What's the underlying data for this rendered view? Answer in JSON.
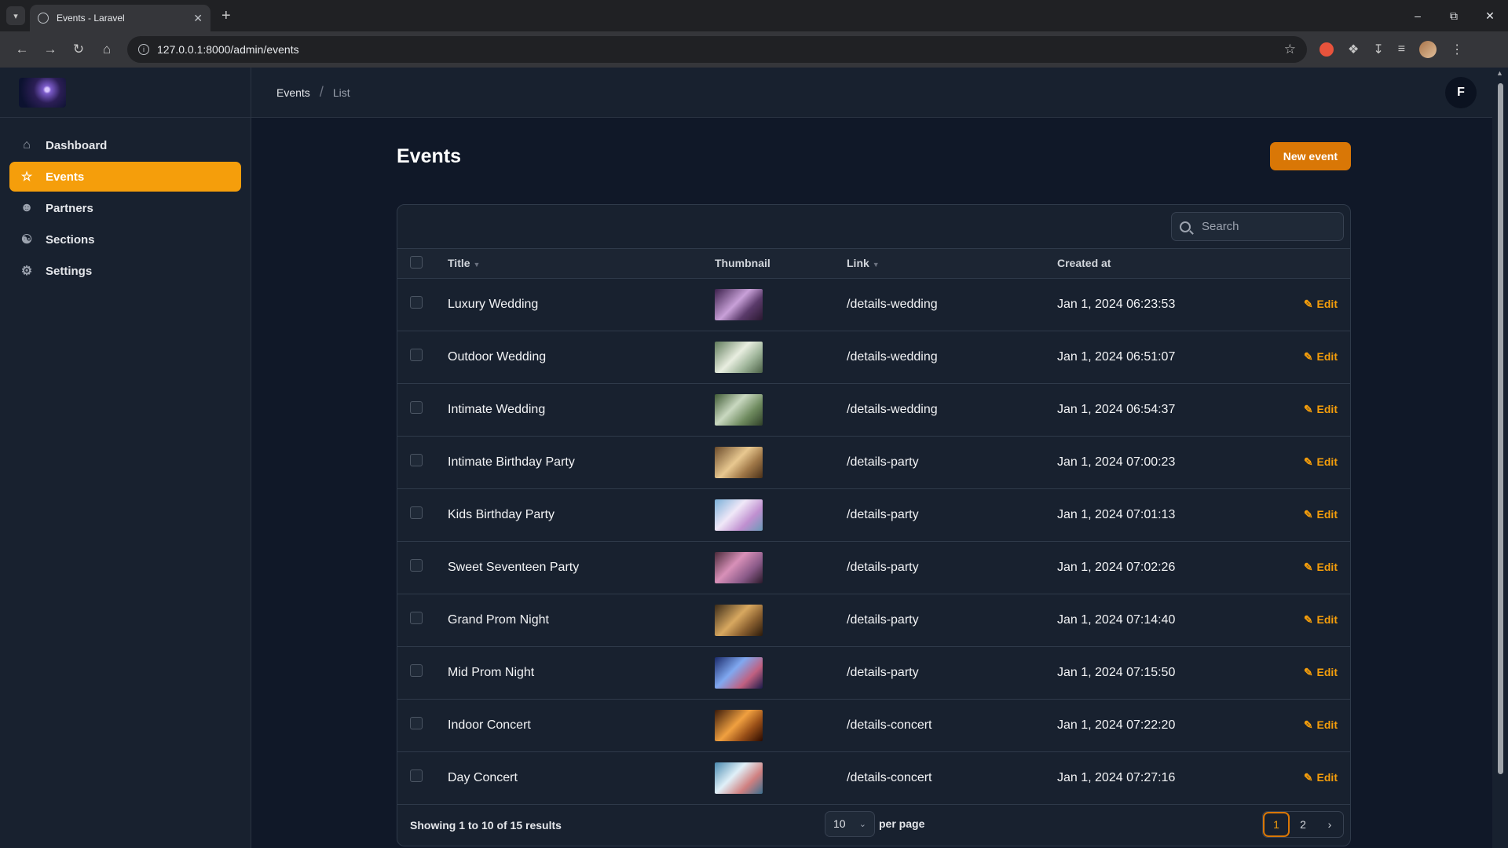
{
  "browser": {
    "tab_title": "Events - Laravel",
    "url": "127.0.0.1:8000/admin/events"
  },
  "sidebar": {
    "items": [
      {
        "label": "Dashboard",
        "icon": "home-icon",
        "active": false
      },
      {
        "label": "Events",
        "icon": "star-icon",
        "active": true
      },
      {
        "label": "Partners",
        "icon": "users-icon",
        "active": false
      },
      {
        "label": "Sections",
        "icon": "user-group-icon",
        "active": false
      },
      {
        "label": "Settings",
        "icon": "gear-icon",
        "active": false
      }
    ]
  },
  "topbar": {
    "breadcrumb": [
      "Events",
      "List"
    ],
    "user_initial": "F"
  },
  "page": {
    "title": "Events",
    "new_button": "New event"
  },
  "table": {
    "search_placeholder": "Search",
    "columns": [
      "Title",
      "Thumbnail",
      "Link",
      "Created at"
    ],
    "rows": [
      {
        "title": "Luxury Wedding",
        "link": "/details-wedding",
        "created": "Jan 1, 2024 06:23:53",
        "action": "Edit"
      },
      {
        "title": "Outdoor Wedding",
        "link": "/details-wedding",
        "created": "Jan 1, 2024 06:51:07",
        "action": "Edit"
      },
      {
        "title": "Intimate Wedding",
        "link": "/details-wedding",
        "created": "Jan 1, 2024 06:54:37",
        "action": "Edit"
      },
      {
        "title": "Intimate Birthday Party",
        "link": "/details-party",
        "created": "Jan 1, 2024 07:00:23",
        "action": "Edit"
      },
      {
        "title": "Kids Birthday Party",
        "link": "/details-party",
        "created": "Jan 1, 2024 07:01:13",
        "action": "Edit"
      },
      {
        "title": "Sweet Seventeen Party",
        "link": "/details-party",
        "created": "Jan 1, 2024 07:02:26",
        "action": "Edit"
      },
      {
        "title": "Grand Prom Night",
        "link": "/details-party",
        "created": "Jan 1, 2024 07:14:40",
        "action": "Edit"
      },
      {
        "title": "Mid Prom Night",
        "link": "/details-party",
        "created": "Jan 1, 2024 07:15:50",
        "action": "Edit"
      },
      {
        "title": "Indoor Concert",
        "link": "/details-concert",
        "created": "Jan 1, 2024 07:22:20",
        "action": "Edit"
      },
      {
        "title": "Day Concert",
        "link": "/details-concert",
        "created": "Jan 1, 2024 07:27:16",
        "action": "Edit"
      }
    ],
    "footer": {
      "showing": "Showing 1 to 10 of 15 results",
      "per_page_value": "10",
      "per_page_label": "per page",
      "pages": [
        "1",
        "2"
      ],
      "current_page": "1"
    }
  },
  "colors": {
    "accent": "#f59e0b",
    "background": "#101828",
    "panel": "#18212f"
  }
}
